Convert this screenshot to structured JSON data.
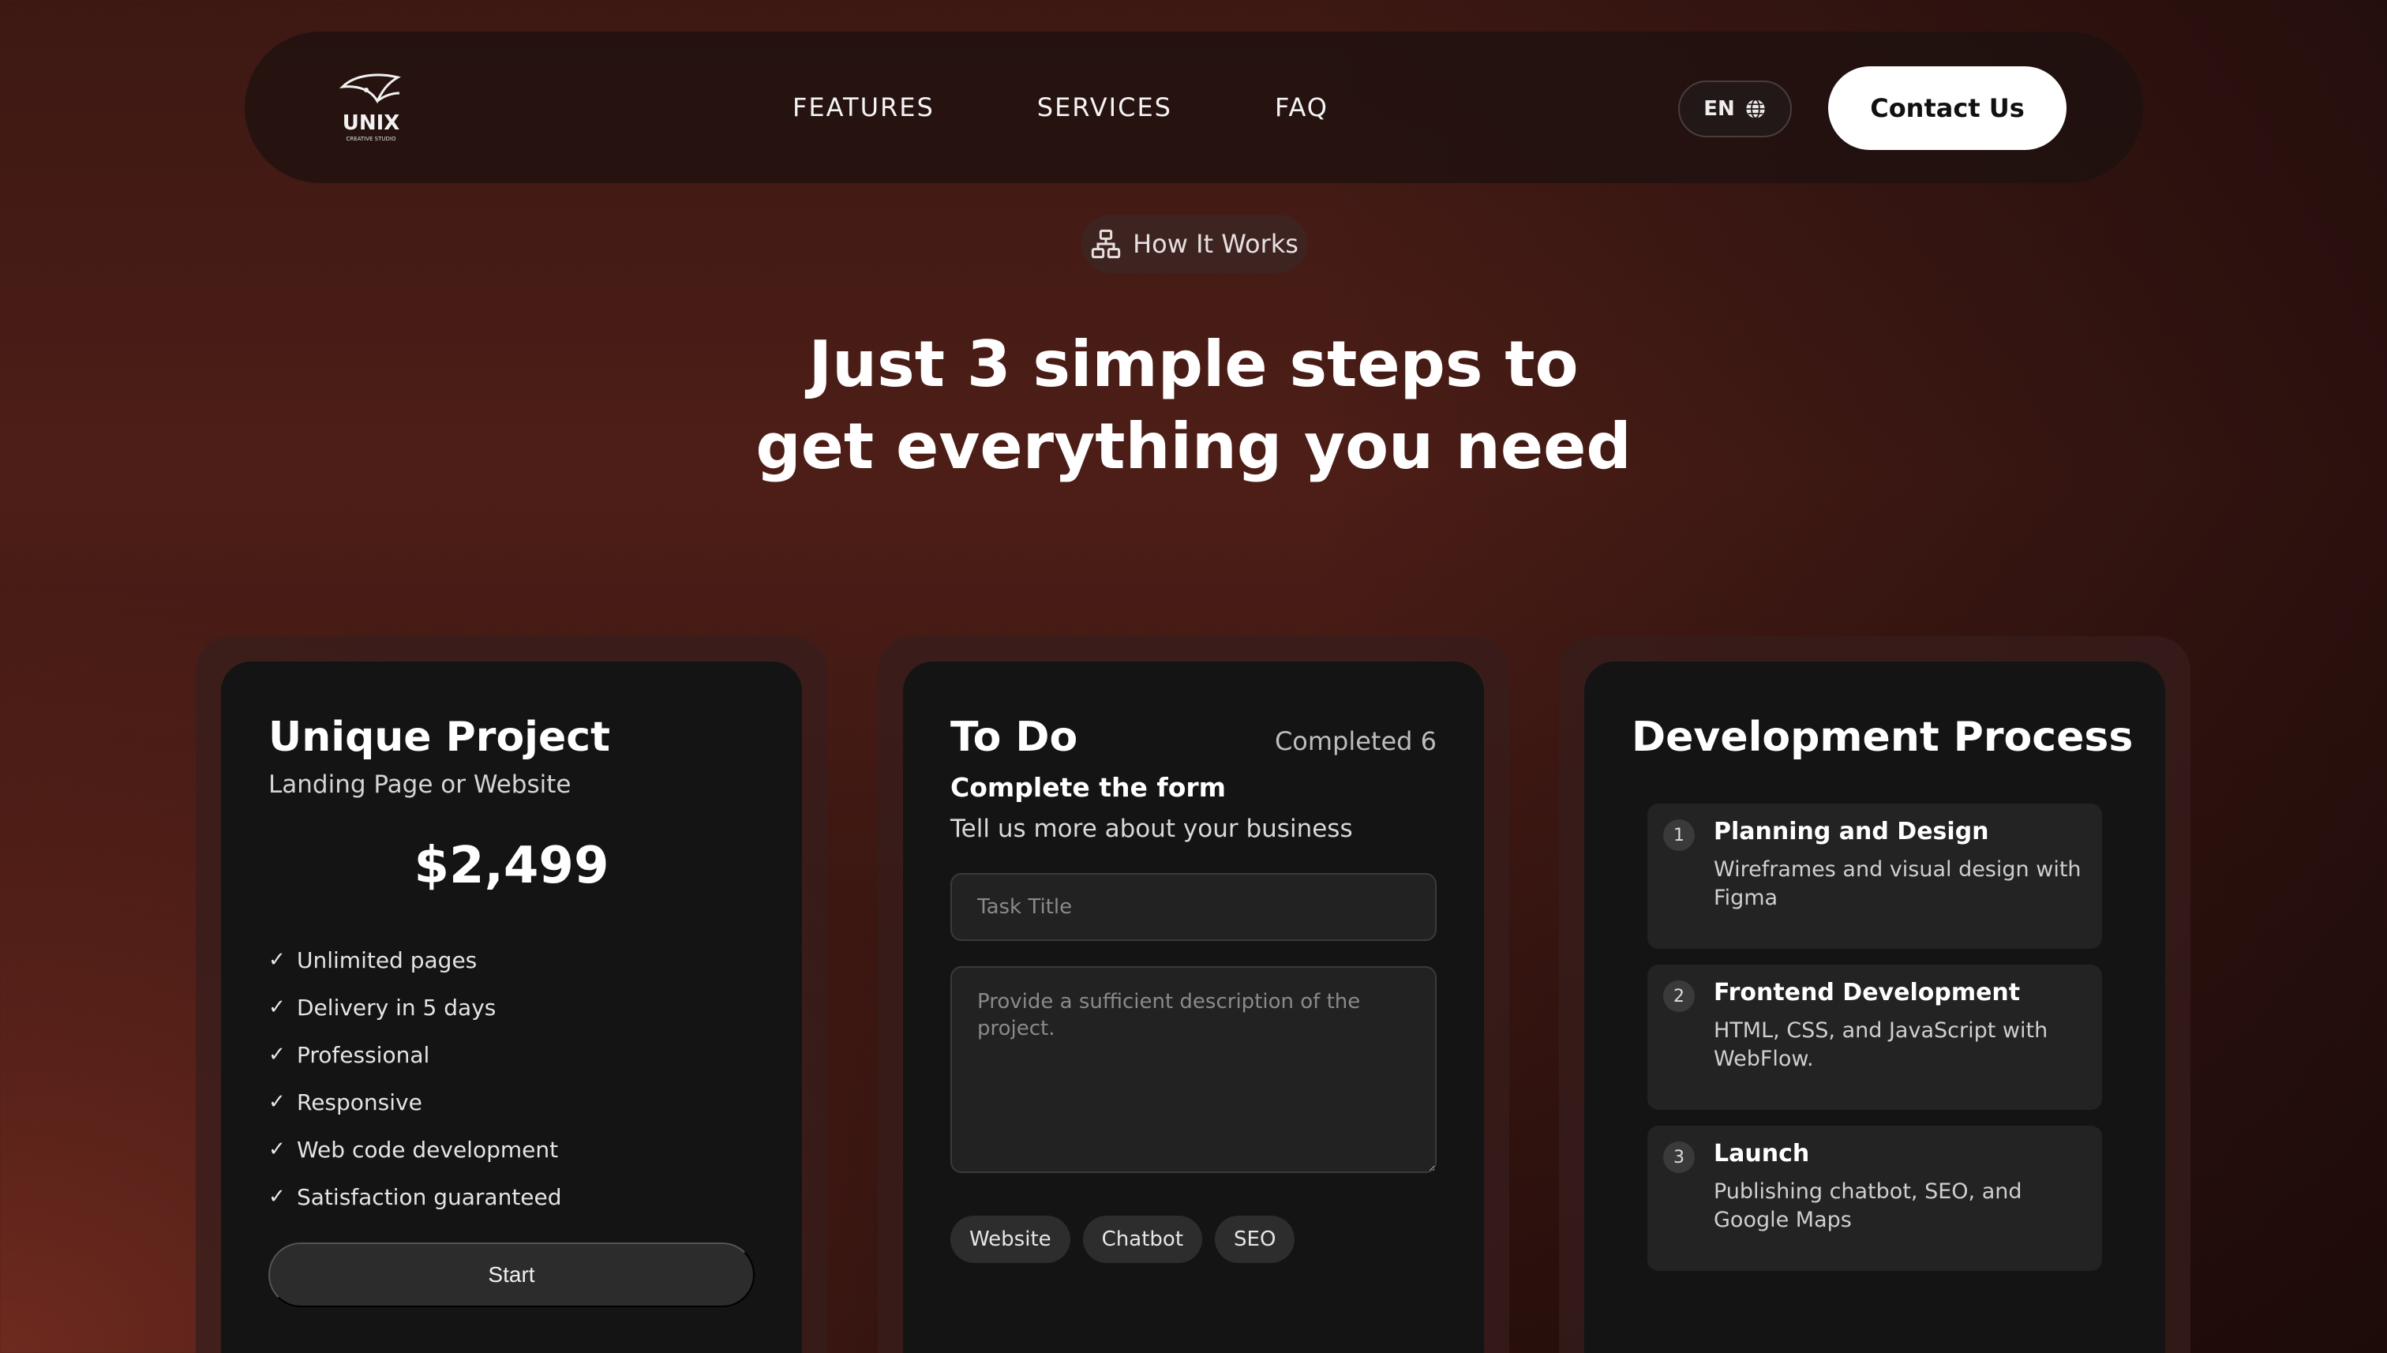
{
  "nav": {
    "logo_text": "UNIX",
    "logo_sub": "CREATIVE STUDIO",
    "links": [
      "FEATURES",
      "SERVICES",
      "FAQ"
    ],
    "lang": "EN",
    "contact": "Contact Us"
  },
  "badge": {
    "label": "How It Works",
    "icon": "sitemap-icon"
  },
  "headline": {
    "line1": "Just 3 simple steps to",
    "line2": "get everything you need"
  },
  "pricing": {
    "title": "Unique Project",
    "subtitle": "Landing Page or Website",
    "price": "$2,499",
    "features": [
      "Unlimited pages",
      "Delivery in 5 days",
      "Professional",
      "Responsive",
      "Web code development",
      "Satisfaction guaranteed"
    ],
    "cta": "Start"
  },
  "todo": {
    "title": "To Do",
    "completed": "Completed 6",
    "form_title": "Complete the form",
    "form_desc": "Tell us more about your business",
    "task_placeholder": "Task Title",
    "desc_placeholder": "Provide a sufficient description of the project.",
    "chips": [
      "Website",
      "Chatbot",
      "SEO"
    ]
  },
  "process": {
    "title": "Development Process",
    "steps": [
      {
        "num": "1",
        "title": "Planning and Design",
        "desc": "Wireframes and visual design with Figma"
      },
      {
        "num": "2",
        "title": "Frontend Development",
        "desc": "HTML, CSS, and JavaScript with WebFlow."
      },
      {
        "num": "3",
        "title": "Launch",
        "desc": "Publishing chatbot, SEO, and Google Maps"
      }
    ]
  }
}
